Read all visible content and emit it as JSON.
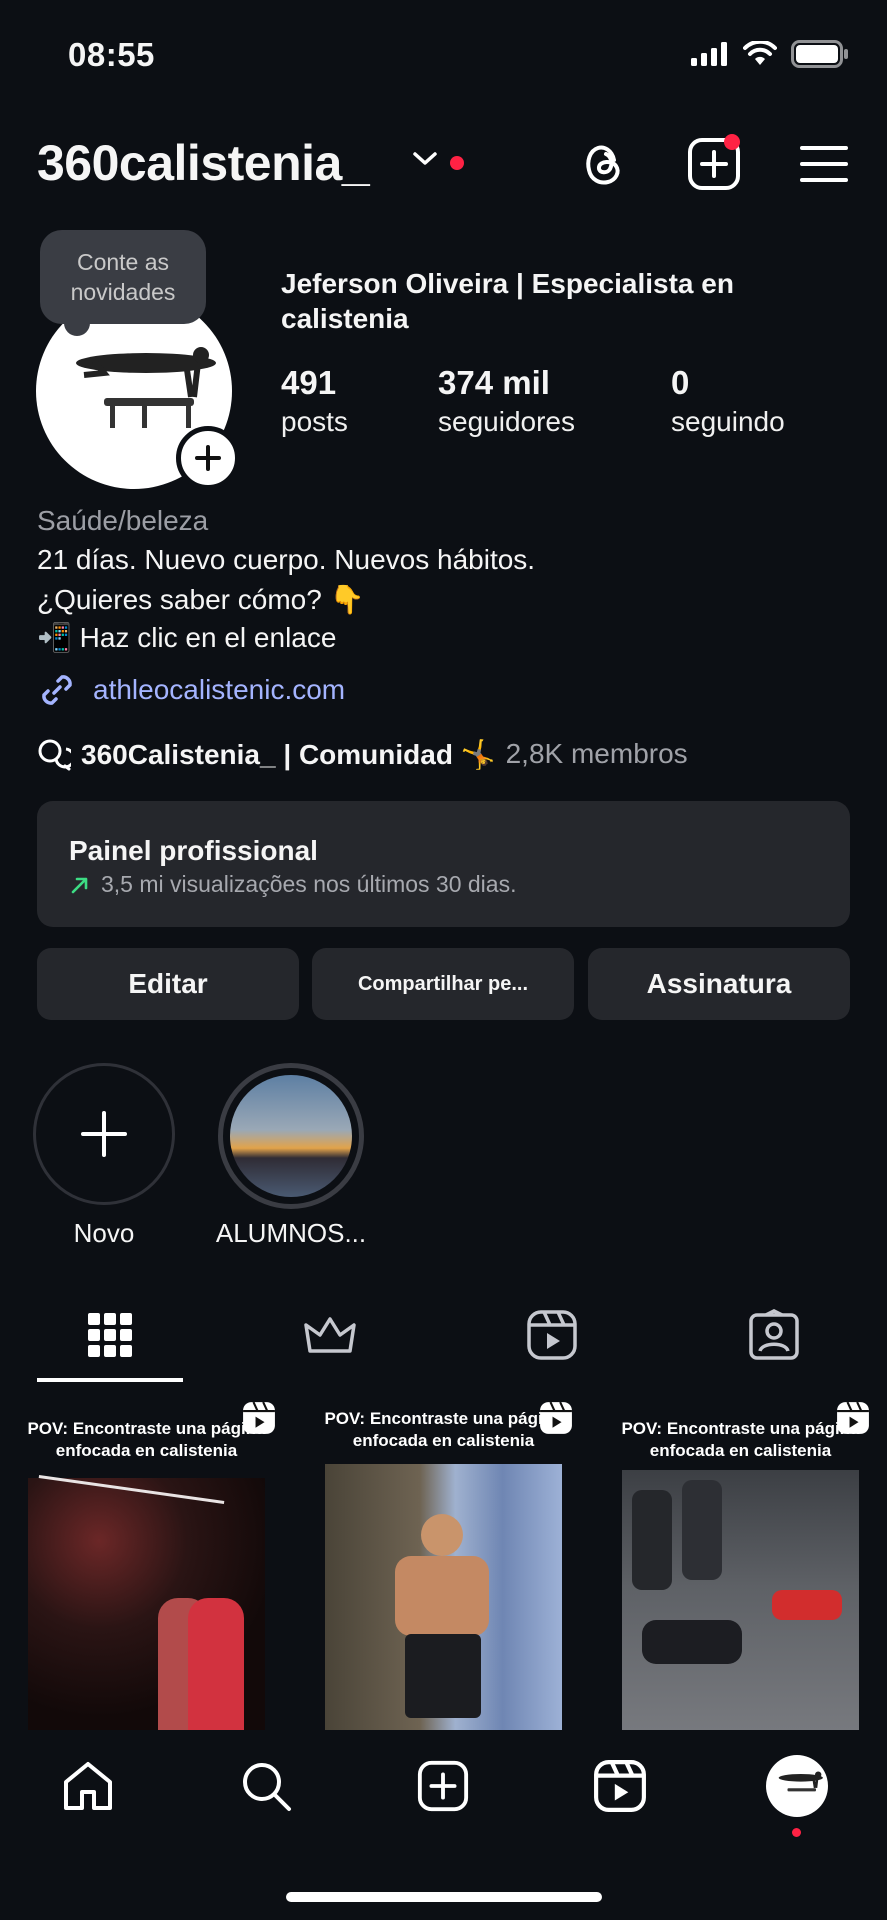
{
  "status_bar": {
    "time": "08:55"
  },
  "header": {
    "username": "360calistenia_"
  },
  "profile": {
    "bubble_text": [
      "Conte as",
      "novidades"
    ],
    "full_name": "Jeferson Oliveira | Especialista en calistenia",
    "stats": [
      {
        "value": "491",
        "label": "posts"
      },
      {
        "value": "374 mil",
        "label": "seguidores"
      },
      {
        "value": "0",
        "label": "seguindo"
      }
    ],
    "category": "Saúde/beleza",
    "bio": [
      "21 días. Nuevo cuerpo. Nuevos hábitos.",
      "¿Quieres saber cómo? 👇",
      "📲 Haz clic en el enlace"
    ],
    "link": "athleocalistenic.com",
    "community": {
      "name": "360Calistenia_ | Comunidad 🤸",
      "members": "2,8K membros"
    }
  },
  "dashboard": {
    "title": "Painel profissional",
    "subtitle": "3,5 mi visualizações nos últimos 30 dias."
  },
  "buttons": {
    "edit": "Editar",
    "share": "Compartilhar pe...",
    "subscription": "Assinatura"
  },
  "highlights": [
    {
      "label": "Novo"
    },
    {
      "label": "ALUMNOS..."
    }
  ],
  "tabs": [
    "grid",
    "subscriptions",
    "reels",
    "tagged"
  ],
  "posts": [
    {
      "caption": "POV: Encontraste una página enfocada en calistenia"
    },
    {
      "caption": "POV: Encontraste una página enfocada en calistenia"
    },
    {
      "caption": "POV: Encontraste una página enfocada en calistenia"
    }
  ],
  "colors": {
    "background": "#0c0f14",
    "card": "#25272c",
    "link": "#a4b4ff",
    "notification": "#ff2244",
    "trend": "#3ddc84"
  }
}
